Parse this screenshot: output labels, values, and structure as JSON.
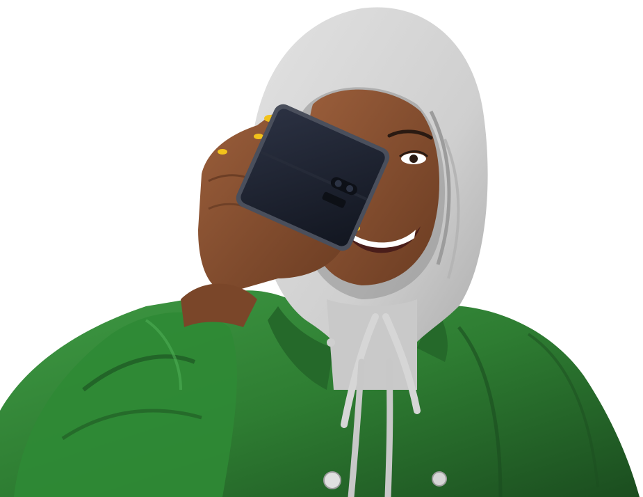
{
  "scene": {
    "background_color": "#ffffff",
    "hoodie_color": "#cfcfcf",
    "hoodie_shadow": "#a8a8a8",
    "jacket_color": "#2e7d32",
    "jacket_shadow": "#1b4d1f",
    "skin_color": "#8a5233",
    "skin_shadow": "#5e3520",
    "phone_color": "#1d2230",
    "phone_frame": "#4a4f5c",
    "nail_color": "#f2c21b"
  },
  "figure": {
    "subject": "person-in-green-leather-jacket-and-grey-hoodie",
    "object": "foldable-phone"
  }
}
